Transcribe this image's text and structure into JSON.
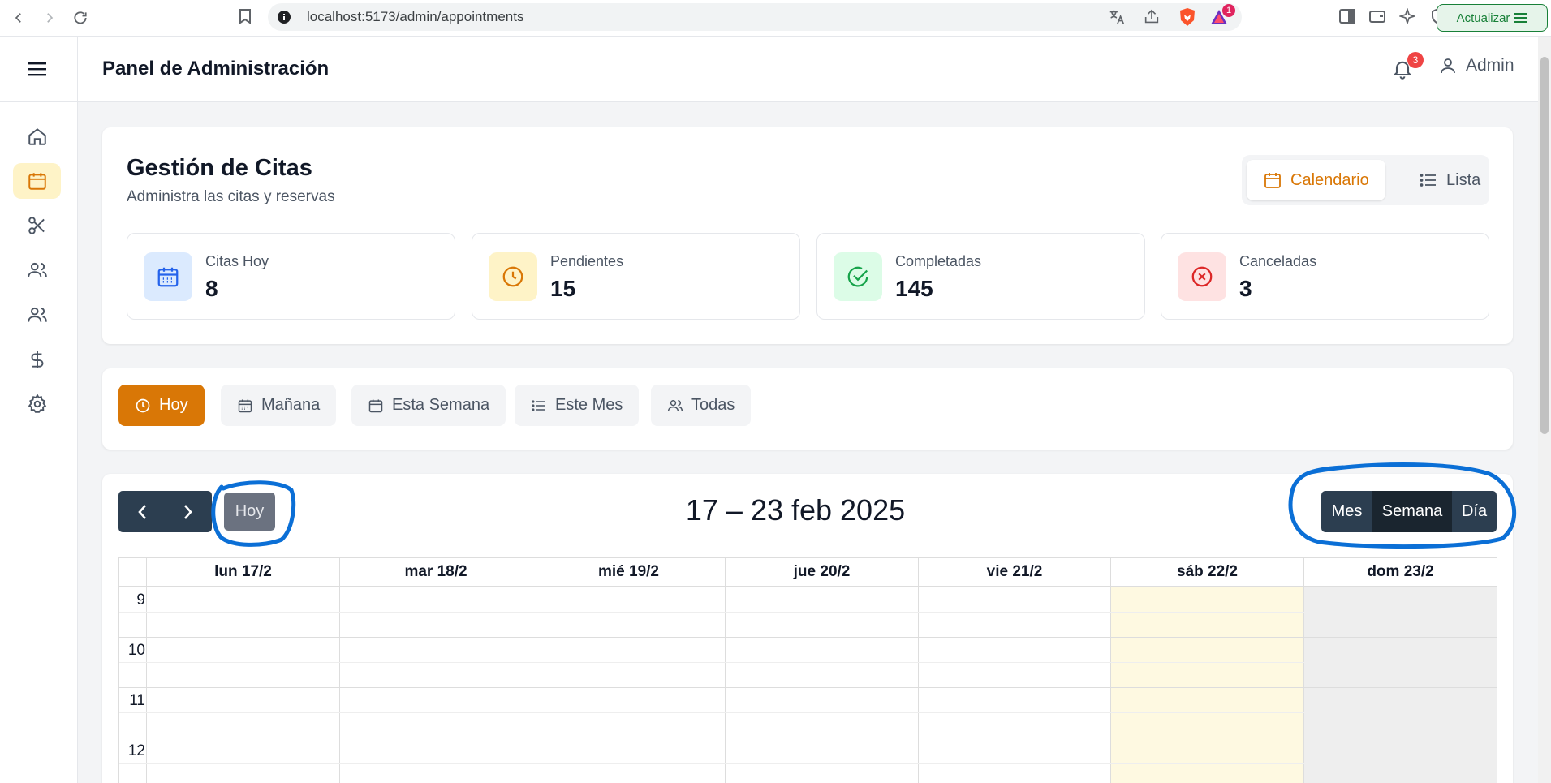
{
  "browser": {
    "url": "localhost:5173/admin/appointments",
    "update_label": "Actualizar",
    "brave_badge": "1"
  },
  "header": {
    "title": "Panel de Administración",
    "notifications_count": "3",
    "user_label": "Admin"
  },
  "sidebar": {
    "items": [
      {
        "icon": "home-icon"
      },
      {
        "icon": "calendar-icon",
        "active": true
      },
      {
        "icon": "scissors-icon"
      },
      {
        "icon": "users-icon"
      },
      {
        "icon": "users-icon"
      },
      {
        "icon": "dollar-icon"
      },
      {
        "icon": "gear-icon"
      }
    ]
  },
  "page": {
    "title": "Gestión de Citas",
    "subtitle": "Administra las citas y reservas",
    "view_toggle": {
      "calendar_label": "Calendario",
      "list_label": "Lista"
    }
  },
  "stats": [
    {
      "label": "Citas Hoy",
      "value": "8",
      "icon": "calendar-icon",
      "color": "#2563eb",
      "bg": "#dbeafe"
    },
    {
      "label": "Pendientes",
      "value": "15",
      "icon": "clock-icon",
      "color": "#d97706",
      "bg": "#fef3c7"
    },
    {
      "label": "Completadas",
      "value": "145",
      "icon": "check-circle-icon",
      "color": "#16a34a",
      "bg": "#dcfce7"
    },
    {
      "label": "Canceladas",
      "value": "3",
      "icon": "x-circle-icon",
      "color": "#dc2626",
      "bg": "#fee2e2"
    }
  ],
  "filters": [
    {
      "label": "Hoy",
      "icon": "clock-icon",
      "active": true
    },
    {
      "label": "Mañana",
      "icon": "calendar-icon"
    },
    {
      "label": "Esta Semana",
      "icon": "calendar-icon"
    },
    {
      "label": "Este Mes",
      "icon": "list-icon"
    },
    {
      "label": "Todas",
      "icon": "users-icon"
    }
  ],
  "calendar": {
    "today_label": "Hoy",
    "range_title": "17 – 23 feb 2025",
    "views": [
      {
        "label": "Mes"
      },
      {
        "label": "Semana",
        "active": true
      },
      {
        "label": "Día"
      }
    ],
    "days": [
      "lun 17/2",
      "mar 18/2",
      "mié 19/2",
      "jue 20/2",
      "vie 21/2",
      "sáb 22/2",
      "dom 23/2"
    ],
    "hours": [
      "9",
      "10",
      "11",
      "12"
    ],
    "colors": {
      "saturday": "#fef9e1",
      "sunday": "#eeeeee",
      "toolbar": "#2c3e50"
    }
  },
  "colors": {
    "accent": "#d97706",
    "annotation": "#0b6fd6"
  }
}
